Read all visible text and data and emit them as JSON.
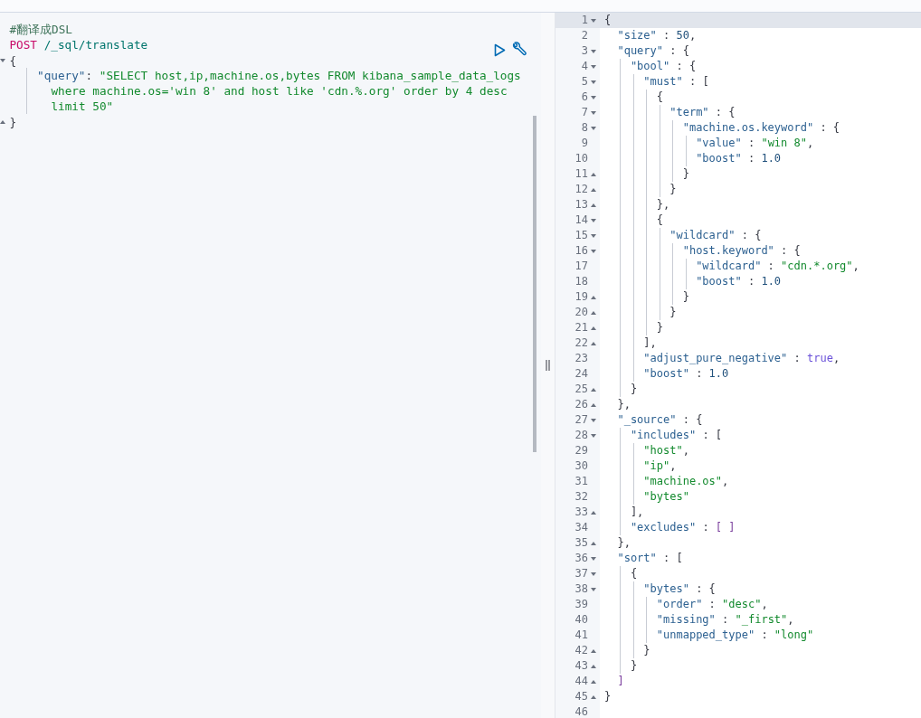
{
  "request_editor": {
    "lines": [
      {
        "fold_start": false,
        "fold_end": false,
        "tokens": [
          {
            "kind": "comment",
            "text": "#翻译成DSL"
          }
        ]
      },
      {
        "fold_start": false,
        "fold_end": false,
        "tokens": [
          {
            "kind": "method",
            "text": "POST"
          },
          {
            "kind": "path",
            "text": " /_sql/translate"
          }
        ]
      },
      {
        "fold_start": true,
        "fold_end": false,
        "tokens": [
          {
            "kind": "punct",
            "text": "{"
          }
        ]
      },
      {
        "fold_start": false,
        "fold_end": false,
        "tokens": [
          {
            "kind": "key",
            "text": "    \"query\""
          },
          {
            "kind": "punct",
            "text": ": "
          },
          {
            "kind": "string",
            "text": "\"SELECT host,ip,machine.os,bytes FROM kibana_sample_data_logs where machine.os='win 8' and host like 'cdn.%.org' order by 4 desc limit 50\""
          }
        ]
      },
      {
        "fold_start": false,
        "fold_end": true,
        "tokens": [
          {
            "kind": "punct",
            "text": "}"
          }
        ]
      }
    ]
  },
  "response_editor": {
    "lines": [
      {
        "no": "1",
        "fold_start": true,
        "fold_end": false,
        "selected": true,
        "tokens": [
          {
            "kind": "punct",
            "text": "{"
          }
        ]
      },
      {
        "no": "2",
        "fold_start": false,
        "fold_end": false,
        "selected": false,
        "tokens": [
          {
            "kind": "key",
            "text": "  \"size\""
          },
          {
            "kind": "punct",
            "text": " : "
          },
          {
            "kind": "number",
            "text": "50"
          },
          {
            "kind": "punct",
            "text": ","
          }
        ]
      },
      {
        "no": "3",
        "fold_start": true,
        "fold_end": false,
        "selected": false,
        "tokens": [
          {
            "kind": "key",
            "text": "  \"query\""
          },
          {
            "kind": "punct",
            "text": " : {"
          }
        ]
      },
      {
        "no": "4",
        "fold_start": true,
        "fold_end": false,
        "selected": false,
        "tokens": [
          {
            "kind": "key",
            "text": "    \"bool\""
          },
          {
            "kind": "punct",
            "text": " : {"
          }
        ]
      },
      {
        "no": "5",
        "fold_start": true,
        "fold_end": false,
        "selected": false,
        "tokens": [
          {
            "kind": "key",
            "text": "      \"must\""
          },
          {
            "kind": "punct",
            "text": " : ["
          }
        ]
      },
      {
        "no": "6",
        "fold_start": true,
        "fold_end": false,
        "selected": false,
        "tokens": [
          {
            "kind": "punct",
            "text": "        {"
          }
        ]
      },
      {
        "no": "7",
        "fold_start": true,
        "fold_end": false,
        "selected": false,
        "tokens": [
          {
            "kind": "key",
            "text": "          \"term\""
          },
          {
            "kind": "punct",
            "text": " : {"
          }
        ]
      },
      {
        "no": "8",
        "fold_start": true,
        "fold_end": false,
        "selected": false,
        "tokens": [
          {
            "kind": "key",
            "text": "            \"machine.os.keyword\""
          },
          {
            "kind": "punct",
            "text": " : {"
          }
        ]
      },
      {
        "no": "9",
        "fold_start": false,
        "fold_end": false,
        "selected": false,
        "tokens": [
          {
            "kind": "key",
            "text": "              \"value\""
          },
          {
            "kind": "punct",
            "text": " : "
          },
          {
            "kind": "string",
            "text": "\"win 8\""
          },
          {
            "kind": "punct",
            "text": ","
          }
        ]
      },
      {
        "no": "10",
        "fold_start": false,
        "fold_end": false,
        "selected": false,
        "tokens": [
          {
            "kind": "key",
            "text": "              \"boost\""
          },
          {
            "kind": "punct",
            "text": " : "
          },
          {
            "kind": "number",
            "text": "1.0"
          }
        ]
      },
      {
        "no": "11",
        "fold_start": false,
        "fold_end": true,
        "selected": false,
        "tokens": [
          {
            "kind": "punct",
            "text": "            }"
          }
        ]
      },
      {
        "no": "12",
        "fold_start": false,
        "fold_end": true,
        "selected": false,
        "tokens": [
          {
            "kind": "punct",
            "text": "          }"
          }
        ]
      },
      {
        "no": "13",
        "fold_start": false,
        "fold_end": true,
        "selected": false,
        "tokens": [
          {
            "kind": "punct",
            "text": "        },"
          }
        ]
      },
      {
        "no": "14",
        "fold_start": true,
        "fold_end": false,
        "selected": false,
        "tokens": [
          {
            "kind": "punct",
            "text": "        {"
          }
        ]
      },
      {
        "no": "15",
        "fold_start": true,
        "fold_end": false,
        "selected": false,
        "tokens": [
          {
            "kind": "key",
            "text": "          \"wildcard\""
          },
          {
            "kind": "punct",
            "text": " : {"
          }
        ]
      },
      {
        "no": "16",
        "fold_start": true,
        "fold_end": false,
        "selected": false,
        "tokens": [
          {
            "kind": "key",
            "text": "            \"host.keyword\""
          },
          {
            "kind": "punct",
            "text": " : {"
          }
        ]
      },
      {
        "no": "17",
        "fold_start": false,
        "fold_end": false,
        "selected": false,
        "tokens": [
          {
            "kind": "key",
            "text": "              \"wildcard\""
          },
          {
            "kind": "punct",
            "text": " : "
          },
          {
            "kind": "string",
            "text": "\"cdn.*.org\""
          },
          {
            "kind": "punct",
            "text": ","
          }
        ]
      },
      {
        "no": "18",
        "fold_start": false,
        "fold_end": false,
        "selected": false,
        "tokens": [
          {
            "kind": "key",
            "text": "              \"boost\""
          },
          {
            "kind": "punct",
            "text": " : "
          },
          {
            "kind": "number",
            "text": "1.0"
          }
        ]
      },
      {
        "no": "19",
        "fold_start": false,
        "fold_end": true,
        "selected": false,
        "tokens": [
          {
            "kind": "punct",
            "text": "            }"
          }
        ]
      },
      {
        "no": "20",
        "fold_start": false,
        "fold_end": true,
        "selected": false,
        "tokens": [
          {
            "kind": "punct",
            "text": "          }"
          }
        ]
      },
      {
        "no": "21",
        "fold_start": false,
        "fold_end": true,
        "selected": false,
        "tokens": [
          {
            "kind": "punct",
            "text": "        }"
          }
        ]
      },
      {
        "no": "22",
        "fold_start": false,
        "fold_end": true,
        "selected": false,
        "tokens": [
          {
            "kind": "punct",
            "text": "      ],"
          }
        ]
      },
      {
        "no": "23",
        "fold_start": false,
        "fold_end": false,
        "selected": false,
        "tokens": [
          {
            "kind": "key",
            "text": "      \"adjust_pure_negative\""
          },
          {
            "kind": "punct",
            "text": " : "
          },
          {
            "kind": "bool",
            "text": "true"
          },
          {
            "kind": "punct",
            "text": ","
          }
        ]
      },
      {
        "no": "24",
        "fold_start": false,
        "fold_end": false,
        "selected": false,
        "tokens": [
          {
            "kind": "key",
            "text": "      \"boost\""
          },
          {
            "kind": "punct",
            "text": " : "
          },
          {
            "kind": "number",
            "text": "1.0"
          }
        ]
      },
      {
        "no": "25",
        "fold_start": false,
        "fold_end": true,
        "selected": false,
        "tokens": [
          {
            "kind": "punct",
            "text": "    }"
          }
        ]
      },
      {
        "no": "26",
        "fold_start": false,
        "fold_end": true,
        "selected": false,
        "tokens": [
          {
            "kind": "punct",
            "text": "  },"
          }
        ]
      },
      {
        "no": "27",
        "fold_start": true,
        "fold_end": false,
        "selected": false,
        "tokens": [
          {
            "kind": "key",
            "text": "  \"_source\""
          },
          {
            "kind": "punct",
            "text": " : {"
          }
        ]
      },
      {
        "no": "28",
        "fold_start": true,
        "fold_end": false,
        "selected": false,
        "tokens": [
          {
            "kind": "key",
            "text": "    \"includes\""
          },
          {
            "kind": "punct",
            "text": " : ["
          }
        ]
      },
      {
        "no": "29",
        "fold_start": false,
        "fold_end": false,
        "selected": false,
        "tokens": [
          {
            "kind": "string",
            "text": "      \"host\""
          },
          {
            "kind": "punct",
            "text": ","
          }
        ]
      },
      {
        "no": "30",
        "fold_start": false,
        "fold_end": false,
        "selected": false,
        "tokens": [
          {
            "kind": "string",
            "text": "      \"ip\""
          },
          {
            "kind": "punct",
            "text": ","
          }
        ]
      },
      {
        "no": "31",
        "fold_start": false,
        "fold_end": false,
        "selected": false,
        "tokens": [
          {
            "kind": "string",
            "text": "      \"machine.os\""
          },
          {
            "kind": "punct",
            "text": ","
          }
        ]
      },
      {
        "no": "32",
        "fold_start": false,
        "fold_end": false,
        "selected": false,
        "tokens": [
          {
            "kind": "string",
            "text": "      \"bytes\""
          }
        ]
      },
      {
        "no": "33",
        "fold_start": false,
        "fold_end": true,
        "selected": false,
        "tokens": [
          {
            "kind": "punct",
            "text": "    ],"
          }
        ]
      },
      {
        "no": "34",
        "fold_start": false,
        "fold_end": false,
        "selected": false,
        "tokens": [
          {
            "kind": "key",
            "text": "    \"excludes\""
          },
          {
            "kind": "punct",
            "text": " : "
          },
          {
            "kind": "bracket",
            "text": "[ ]"
          }
        ]
      },
      {
        "no": "35",
        "fold_start": false,
        "fold_end": true,
        "selected": false,
        "tokens": [
          {
            "kind": "punct",
            "text": "  },"
          }
        ]
      },
      {
        "no": "36",
        "fold_start": true,
        "fold_end": false,
        "selected": false,
        "tokens": [
          {
            "kind": "key",
            "text": "  \"sort\""
          },
          {
            "kind": "punct",
            "text": " : ["
          }
        ]
      },
      {
        "no": "37",
        "fold_start": true,
        "fold_end": false,
        "selected": false,
        "tokens": [
          {
            "kind": "punct",
            "text": "    {"
          }
        ]
      },
      {
        "no": "38",
        "fold_start": true,
        "fold_end": false,
        "selected": false,
        "tokens": [
          {
            "kind": "key",
            "text": "      \"bytes\""
          },
          {
            "kind": "punct",
            "text": " : {"
          }
        ]
      },
      {
        "no": "39",
        "fold_start": false,
        "fold_end": false,
        "selected": false,
        "tokens": [
          {
            "kind": "key",
            "text": "        \"order\""
          },
          {
            "kind": "punct",
            "text": " : "
          },
          {
            "kind": "string",
            "text": "\"desc\""
          },
          {
            "kind": "punct",
            "text": ","
          }
        ]
      },
      {
        "no": "40",
        "fold_start": false,
        "fold_end": false,
        "selected": false,
        "tokens": [
          {
            "kind": "key",
            "text": "        \"missing\""
          },
          {
            "kind": "punct",
            "text": " : "
          },
          {
            "kind": "string",
            "text": "\"_first\""
          },
          {
            "kind": "punct",
            "text": ","
          }
        ]
      },
      {
        "no": "41",
        "fold_start": false,
        "fold_end": false,
        "selected": false,
        "tokens": [
          {
            "kind": "key",
            "text": "        \"unmapped_type\""
          },
          {
            "kind": "punct",
            "text": " : "
          },
          {
            "kind": "string",
            "text": "\"long\""
          }
        ]
      },
      {
        "no": "42",
        "fold_start": false,
        "fold_end": true,
        "selected": false,
        "tokens": [
          {
            "kind": "punct",
            "text": "      }"
          }
        ]
      },
      {
        "no": "43",
        "fold_start": false,
        "fold_end": true,
        "selected": false,
        "tokens": [
          {
            "kind": "punct",
            "text": "    }"
          }
        ]
      },
      {
        "no": "44",
        "fold_start": false,
        "fold_end": true,
        "selected": false,
        "tokens": [
          {
            "kind": "bracket",
            "text": "  ]"
          }
        ]
      },
      {
        "no": "45",
        "fold_start": false,
        "fold_end": true,
        "selected": false,
        "tokens": [
          {
            "kind": "punct",
            "text": "}"
          }
        ]
      },
      {
        "no": "46",
        "fold_start": false,
        "fold_end": false,
        "selected": false
      }
    ]
  }
}
